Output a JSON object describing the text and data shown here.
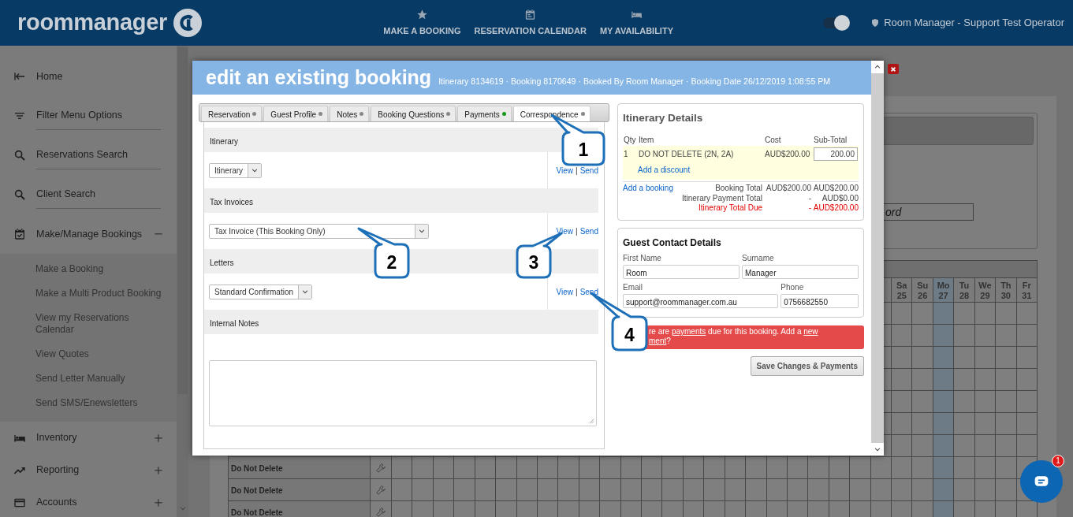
{
  "header": {
    "logo": "roommanager",
    "nav": [
      {
        "label": "MAKE A BOOKING"
      },
      {
        "label": "RESERVATION CALENDAR"
      },
      {
        "label": "MY AVAILABILITY"
      }
    ],
    "toggle": {
      "on": true
    },
    "user": "Room Manager - Support Test Operator"
  },
  "sidebar": {
    "items": [
      {
        "label": "Home"
      },
      {
        "label": "Filter Menu Options"
      },
      {
        "label": "Reservations Search"
      },
      {
        "label": "Client Search"
      },
      {
        "label": "Make/Manage Bookings",
        "expanded": true,
        "children": [
          {
            "label": "Make a Booking"
          },
          {
            "label": "Make a Multi Product Booking"
          },
          {
            "label": "View my Reservations Calendar"
          },
          {
            "label": "View Quotes"
          },
          {
            "label": "Send Letter Manually"
          },
          {
            "label": "Send SMS/Enewsletters"
          }
        ]
      },
      {
        "label": "Inventory",
        "expanded": false
      },
      {
        "label": "Reporting",
        "expanded": false
      },
      {
        "label": "Accounts",
        "expanded": false
      }
    ]
  },
  "background": {
    "search_placeholder": "ord",
    "days": [
      {
        "dow": "Sa",
        "date": "25",
        "selected": false
      },
      {
        "dow": "Su",
        "date": "26",
        "selected": false
      },
      {
        "dow": "Mo",
        "date": "27",
        "selected": true
      },
      {
        "dow": "Tu",
        "date": "28",
        "selected": false
      },
      {
        "dow": "We",
        "date": "29",
        "selected": false
      },
      {
        "dow": "Th",
        "date": "30",
        "selected": false
      },
      {
        "dow": "Fr",
        "date": "31",
        "selected": false
      }
    ],
    "rows": [
      "Do Not Delete",
      "Do Not Delete",
      "Do Not Delete"
    ]
  },
  "modal": {
    "title": "edit an existing booking",
    "meta": "Itinerary 8134619 · Booking 8170649 · Booked By Room Manager · Booking Date 26/12/2019 1:08:55 PM",
    "tabs": [
      {
        "label": "Reservation",
        "selected": false,
        "color": "#888888"
      },
      {
        "label": "Guest Profile",
        "selected": false,
        "color": "#888888"
      },
      {
        "label": "Notes",
        "selected": false,
        "color": "#888888"
      },
      {
        "label": "Booking Questions",
        "selected": false,
        "color": "#888888"
      },
      {
        "label": "Payments",
        "selected": false,
        "color": "#1a9a1a"
      },
      {
        "label": "Correspondence",
        "selected": true,
        "color": "#888888"
      }
    ],
    "sections": [
      {
        "heading": "Itinerary",
        "kind": "template",
        "select": "Itinerary",
        "view": "View",
        "separator": "|",
        "send": "Send"
      },
      {
        "heading": "Tax Invoices",
        "kind": "template",
        "select": "Tax Invoice (This Booking Only)",
        "view": "View",
        "separator": "|",
        "send": "Send"
      },
      {
        "heading": "Letters",
        "kind": "template",
        "select": "Standard Confirmation",
        "view": "View",
        "separator": "|",
        "send": "Send"
      },
      {
        "heading": "Internal Notes",
        "kind": "notes"
      }
    ],
    "itinerary": {
      "title": "Itinerary Details",
      "columns": [
        "Qty",
        "Item",
        "Cost",
        "Sub-Total"
      ],
      "items": [
        {
          "qty": "1",
          "item": "DO NOT DELETE (2N, 2A)",
          "cost": "AUD$200.00",
          "subtotal": "200.00"
        }
      ],
      "discount_link": "Add a discount",
      "add_booking_link": "Add a booking",
      "totals": [
        {
          "label": "Booking Total",
          "kind": "normal",
          "value_1": "AUD$200.00",
          "value_2": "AUD$200.00"
        },
        {
          "label": "Itinerary Payment Total",
          "kind": "normal",
          "value_1": "-",
          "value_2": "AUD$0.00"
        },
        {
          "label": "Itinerary Total Due",
          "kind": "due",
          "value_1": "-",
          "value_2": "AUD$200.00"
        }
      ]
    },
    "contact": {
      "title": "Guest Contact Details",
      "fields": [
        {
          "label": "First Name",
          "value": "Room"
        },
        {
          "label": "Surname",
          "value": "Manager"
        },
        {
          "label": "Email",
          "value": "support@roommanager.com.au"
        },
        {
          "label": "Phone",
          "value": "0756682550"
        }
      ]
    },
    "alert": {
      "lines": [
        [
          {
            "text": "re are ",
            "link": false
          },
          {
            "text": "payments",
            "link": true
          },
          {
            "text": " due for this booking. Add a ",
            "link": false
          },
          {
            "text": "new",
            "link": true
          }
        ],
        [
          {
            "text": "ment",
            "link": true
          },
          {
            "text": "?",
            "link": false
          }
        ]
      ]
    },
    "save_button": "Save Changes & Payments"
  },
  "callouts": [
    {
      "number": "1"
    },
    {
      "number": "2"
    },
    {
      "number": "3"
    },
    {
      "number": "4"
    }
  ],
  "chat": {
    "badge": "1"
  }
}
